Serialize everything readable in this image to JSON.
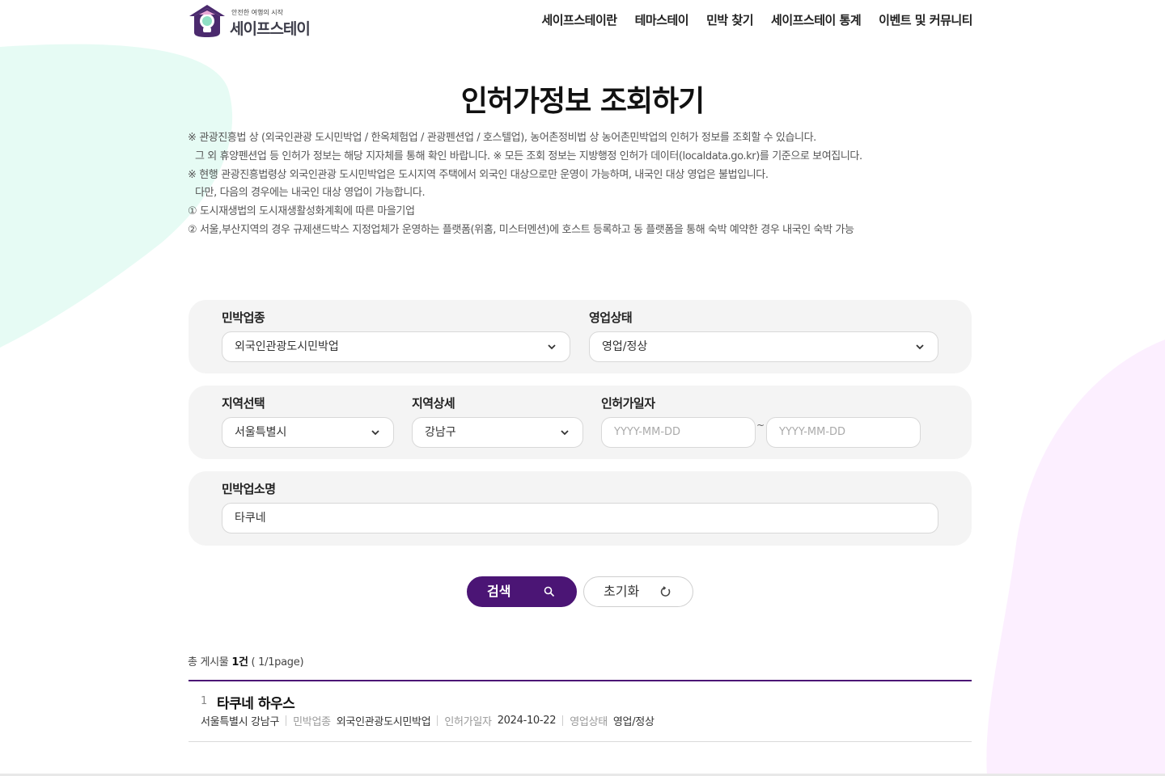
{
  "header": {
    "logo_tagline": "안전한 여행의 시작",
    "logo_name": "세이프스테이",
    "nav": [
      "세이프스테이란",
      "테마스테이",
      "민박 찾기",
      "세이프스테이 통계",
      "이벤트 및 커뮤니티"
    ]
  },
  "page_title": "인허가정보 조회하기",
  "notes": [
    "※ 관광진흥법 상 (외국인관광 도시민박업 / 한옥체험업 / 관광펜션업 / 호스텔업), 농어촌정비법 상 농어촌민박업의 인허가 정보를 조회할 수 있습니다.",
    "  그 외 휴양펜션업 등 인허가 정보는 해당 지자체를 통해 확인 바랍니다. ※ 모든 조회 정보는 지방행정 인허가 데이터(localdata.go.kr)를 기준으로 보여집니다.",
    "※ 현행 관광진흥법령상 외국인관광 도시민박업은 도시지역 주택에서 외국인 대상으로만 운영이 가능하며, 내국인 대상 영업은 불법입니다.",
    "  다만, 다음의 경우에는 내국인 대상 영업이 가능합니다.",
    "① 도시재생법의 도시재생활성화계획에 따른 마을기업",
    "② 서울,부산지역의 경우 규제샌드박스 지정업체가 운영하는 플랫폼(위홈, 미스터멘션)에 호스트 등록하고 동 플랫폼을 통해 숙박 예약한 경우 내국인 숙박 가능"
  ],
  "form": {
    "type_label": "민박업종",
    "type_value": "외국인관광도시민박업",
    "status_label": "영업상태",
    "status_value": "영업/정상",
    "region_label": "지역선택",
    "region_value": "서울특별시",
    "district_label": "지역상세",
    "district_value": "강남구",
    "date_label": "인허가일자",
    "date_from_placeholder": "YYYY-MM-DD",
    "date_to_placeholder": "YYYY-MM-DD",
    "date_sep": "~",
    "name_label": "민박업소명",
    "name_value": "타쿠네"
  },
  "buttons": {
    "search": "검색",
    "reset": "초기화"
  },
  "results": {
    "count_prefix": "총 게시물 ",
    "count": "1건",
    "page_info": " ( 1/1page)",
    "items": [
      {
        "num": "1",
        "name": "타쿠네 하우스",
        "address": "서울특별시 강남구",
        "type_key": "민박업종",
        "type_value": "외국인관광도시민박업",
        "date_key": "인허가일자",
        "date_value": "2024-10-22",
        "status_key": "영업상태",
        "status_value": "영업/정상"
      }
    ]
  },
  "colors": {
    "accent": "#4b1575",
    "bg_mint": "#e6fbf4",
    "bg_pink": "#fcefff",
    "panel": "#f4f4f4"
  },
  "icons": {
    "search_button": "search-icon",
    "reset_button": "refresh-icon",
    "selects": "chevron-down-icon"
  }
}
